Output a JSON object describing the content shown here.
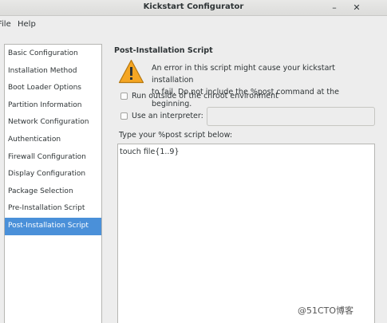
{
  "window": {
    "title": "Kickstart Configurator",
    "minimize_glyph": "–",
    "close_glyph": "✕"
  },
  "menubar": {
    "file": "File",
    "help": "Help"
  },
  "sidebar": {
    "items": [
      {
        "label": "Basic Configuration"
      },
      {
        "label": "Installation Method"
      },
      {
        "label": "Boot Loader Options"
      },
      {
        "label": "Partition Information"
      },
      {
        "label": "Network Configuration"
      },
      {
        "label": "Authentication"
      },
      {
        "label": "Firewall Configuration"
      },
      {
        "label": "Display Configuration"
      },
      {
        "label": "Package Selection"
      },
      {
        "label": "Pre-Installation Script"
      },
      {
        "label": "Post-Installation Script"
      }
    ],
    "selected": "Post-Installation Script",
    "selected_color": "#4a90d9"
  },
  "main": {
    "title": "Post-Installation Script",
    "warning_line1": "An error in this script might cause your kickstart installation",
    "warning_line2": "to fail. Do not include the %post command at the beginning.",
    "warning_icon": "warning-triangle-icon",
    "warning_color": "#f5a623",
    "chroot_checkbox_label": "Run outside of the chroot environment",
    "interpreter_checkbox_label": "Use an interpreter:",
    "interpreter_value": "",
    "script_label": "Type your %post script below:",
    "script_value": "touch file{1..9}"
  },
  "watermark": "@51CTO博客"
}
